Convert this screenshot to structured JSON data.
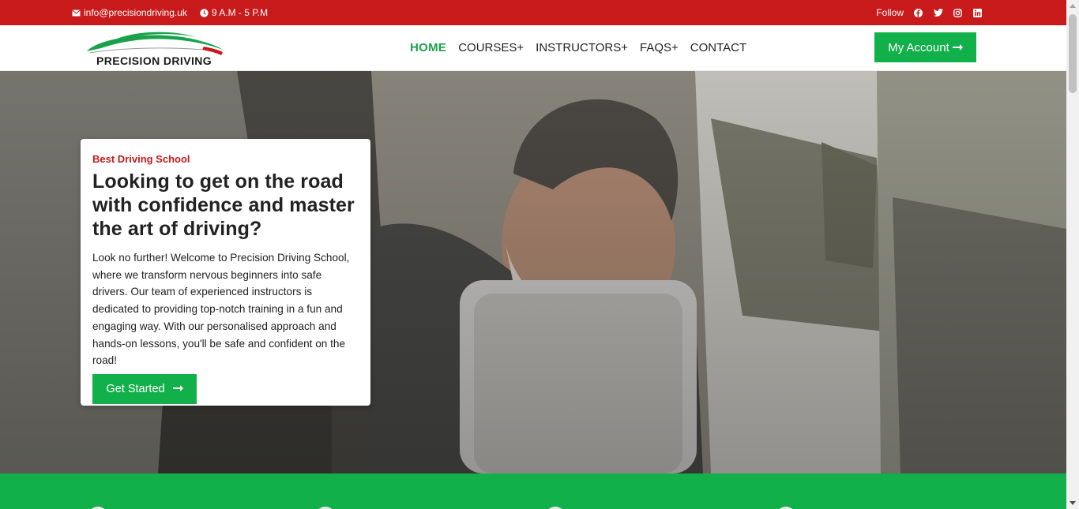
{
  "topbar": {
    "email": "info@precisiondriving.uk",
    "hours": "9 A.M - 5 P.M",
    "follow_label": "Follow",
    "social_icons": [
      "facebook-icon",
      "twitter-icon",
      "instagram-icon",
      "linkedin-icon"
    ]
  },
  "header": {
    "logo_text": "PRECISION DRIVING",
    "nav": [
      {
        "label": "HOME",
        "active": true
      },
      {
        "label": "COURSES+"
      },
      {
        "label": "INSTRUCTORS+"
      },
      {
        "label": "FAQS+"
      },
      {
        "label": "CONTACT"
      }
    ],
    "account_label": "My Account"
  },
  "hero": {
    "kicker": "Best Driving School",
    "title": "Looking to get on the road with confidence and master the art of driving?",
    "body": "Look no further! Welcome to Precision Driving School, where we transform nervous beginners into safe drivers. Our team of experienced instructors is dedicated to providing top-notch training in a fun and engaging way. With our personalised approach and hands-on lessons, you'll be safe and confident on the road!",
    "cta_label": "Get Started"
  },
  "colors": {
    "topbar": "#c8191b",
    "accent_green": "#12b04a",
    "kicker_red": "#c8191b"
  }
}
